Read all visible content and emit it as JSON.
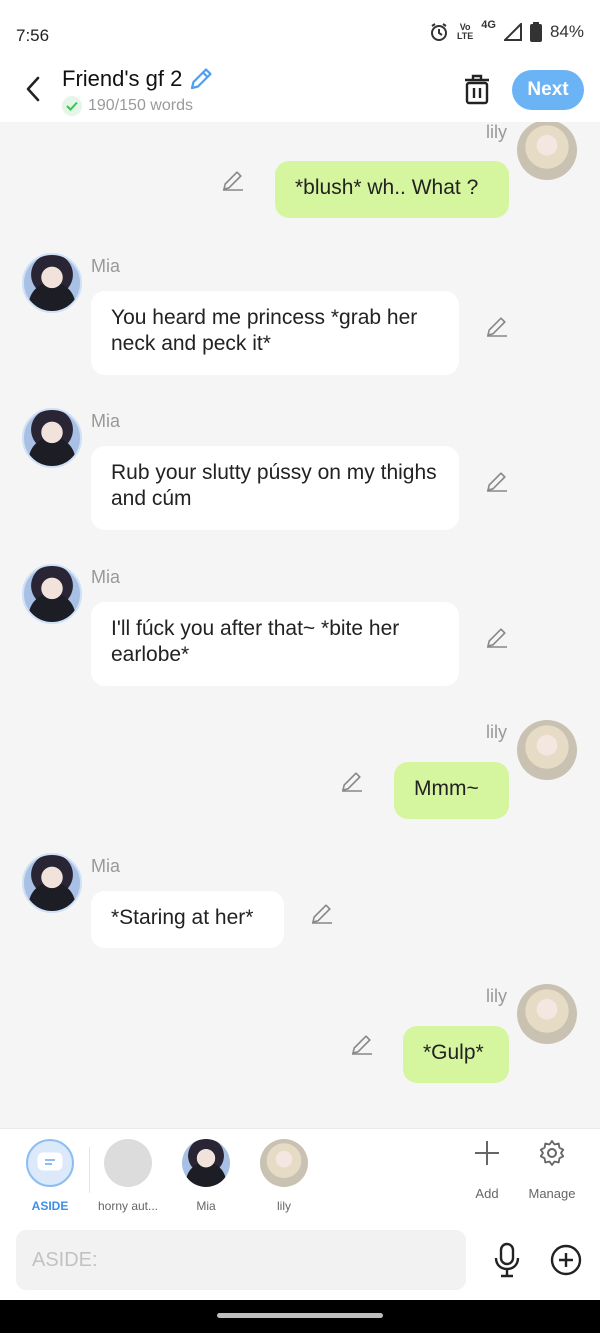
{
  "status": {
    "time": "7:56",
    "volte_top": "Vo",
    "volte_bottom": "LTE",
    "network": "4G",
    "battery": "84%"
  },
  "header": {
    "title": "Friend's gf 2",
    "word_count": "190/150 words",
    "next_label": "Next"
  },
  "colors": {
    "accent": "#6ab3f5",
    "user_bubble": "#d6f59f",
    "bot_bubble": "#ffffff",
    "background": "#f5f5f5"
  },
  "messages": [
    {
      "sender": "lily",
      "text": "*blush* wh.. What ?"
    },
    {
      "sender": "Mia",
      "text": "You heard me princess *grab her neck and peck it*"
    },
    {
      "sender": "Mia",
      "text": "Rub your slutty pússy on my thighs and cúm"
    },
    {
      "sender": "Mia",
      "text": "I'll fúck you after that~ *bite her earlobe*"
    },
    {
      "sender": "lily",
      "text": "Mmm~"
    },
    {
      "sender": "Mia",
      "text": "*Staring at her*"
    },
    {
      "sender": "lily",
      "text": "*Gulp*"
    }
  ],
  "tabs": {
    "aside": "ASIDE",
    "horny": "horny aut...",
    "mia": "Mia",
    "lily": "lily",
    "add": "Add",
    "manage": "Manage"
  },
  "input": {
    "placeholder": "ASIDE:"
  }
}
